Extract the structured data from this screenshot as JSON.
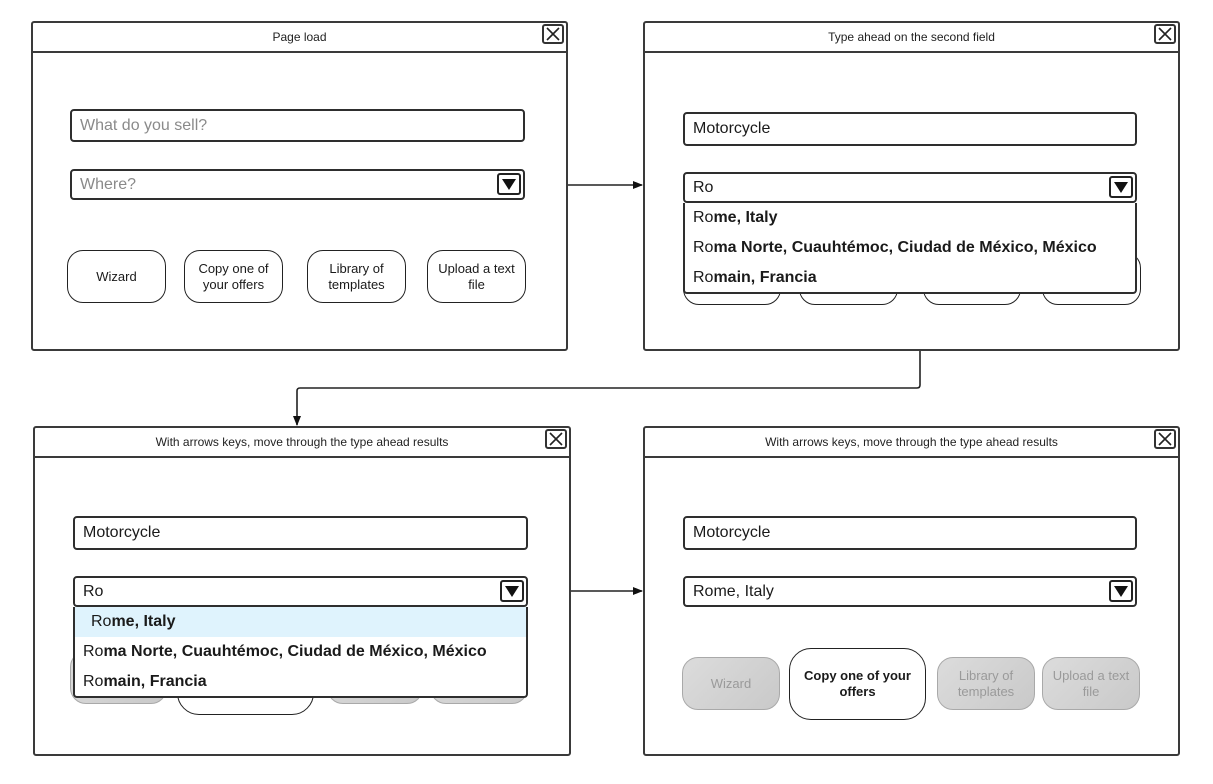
{
  "panels": [
    {
      "title": "Page load",
      "product_field": {
        "placeholder": "What do you sell?",
        "value": ""
      },
      "location_field": {
        "placeholder": "Where?",
        "value": ""
      },
      "buttons": [
        {
          "label": "Wizard",
          "state": "normal"
        },
        {
          "label": "Copy one of your offers",
          "state": "normal"
        },
        {
          "label": "Library of templates",
          "state": "normal"
        },
        {
          "label": "Upload a text file",
          "state": "normal"
        }
      ]
    },
    {
      "title": "Type ahead on the second field",
      "product_field": {
        "value": "Motorcycle"
      },
      "location_field": {
        "value": "Ro"
      },
      "suggestions": [
        {
          "typed": "Ro",
          "rest": "me, Italy"
        },
        {
          "typed": "Ro",
          "rest": "ma Norte, Cuauhtémoc, Ciudad de México, México"
        },
        {
          "typed": "Ro",
          "rest": "main, Francia"
        }
      ]
    },
    {
      "title": "With arrows keys, move through the type ahead results",
      "product_field": {
        "value": "Motorcycle"
      },
      "location_field": {
        "value": "Ro"
      },
      "highlighted_index": 0,
      "suggestions": [
        {
          "typed": "Ro",
          "rest": "me, Italy"
        },
        {
          "typed": "Ro",
          "rest": "ma Norte, Cuauhtémoc, Ciudad de México, México"
        },
        {
          "typed": "Ro",
          "rest": "main, Francia"
        }
      ]
    },
    {
      "title": "With arrows keys, move through the type ahead results",
      "product_field": {
        "value": "Motorcycle"
      },
      "location_field": {
        "value": "Rome, Italy"
      },
      "buttons": [
        {
          "label": "Wizard",
          "state": "disabled"
        },
        {
          "label": "Copy one of your offers",
          "state": "active"
        },
        {
          "label": "Library of templates",
          "state": "disabled"
        },
        {
          "label": "Upload a text file",
          "state": "disabled"
        }
      ]
    }
  ],
  "colors": {
    "border": "#2e2e2e",
    "highlight": "#dff3fd",
    "placeholder": "#8a8a8a",
    "disabled_fill": "#d2d2d2",
    "disabled_text": "#9a9a9a"
  }
}
